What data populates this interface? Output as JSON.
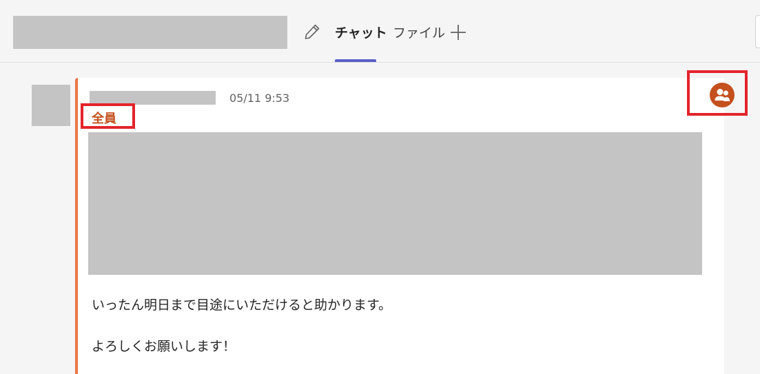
{
  "header": {
    "tabs": [
      {
        "label": "チャット",
        "active": true
      },
      {
        "label": "ファイル",
        "active": false
      }
    ],
    "icons": {
      "edit": "pencil-icon",
      "add_tab": "plus-icon"
    },
    "accent_color": "#5b5fc7"
  },
  "message": {
    "timestamp": "05/11 9:53",
    "mention": "全員",
    "lines": [
      "いったん明日まで目途にいただけると助かります。",
      "よろしくお願いします！"
    ],
    "accent_color": "#e97548",
    "mention_color": "#c4501d"
  },
  "team_mention": {
    "icon": "team-people-icon",
    "color": "#c4501d"
  },
  "highlight_color": "#e3242b"
}
